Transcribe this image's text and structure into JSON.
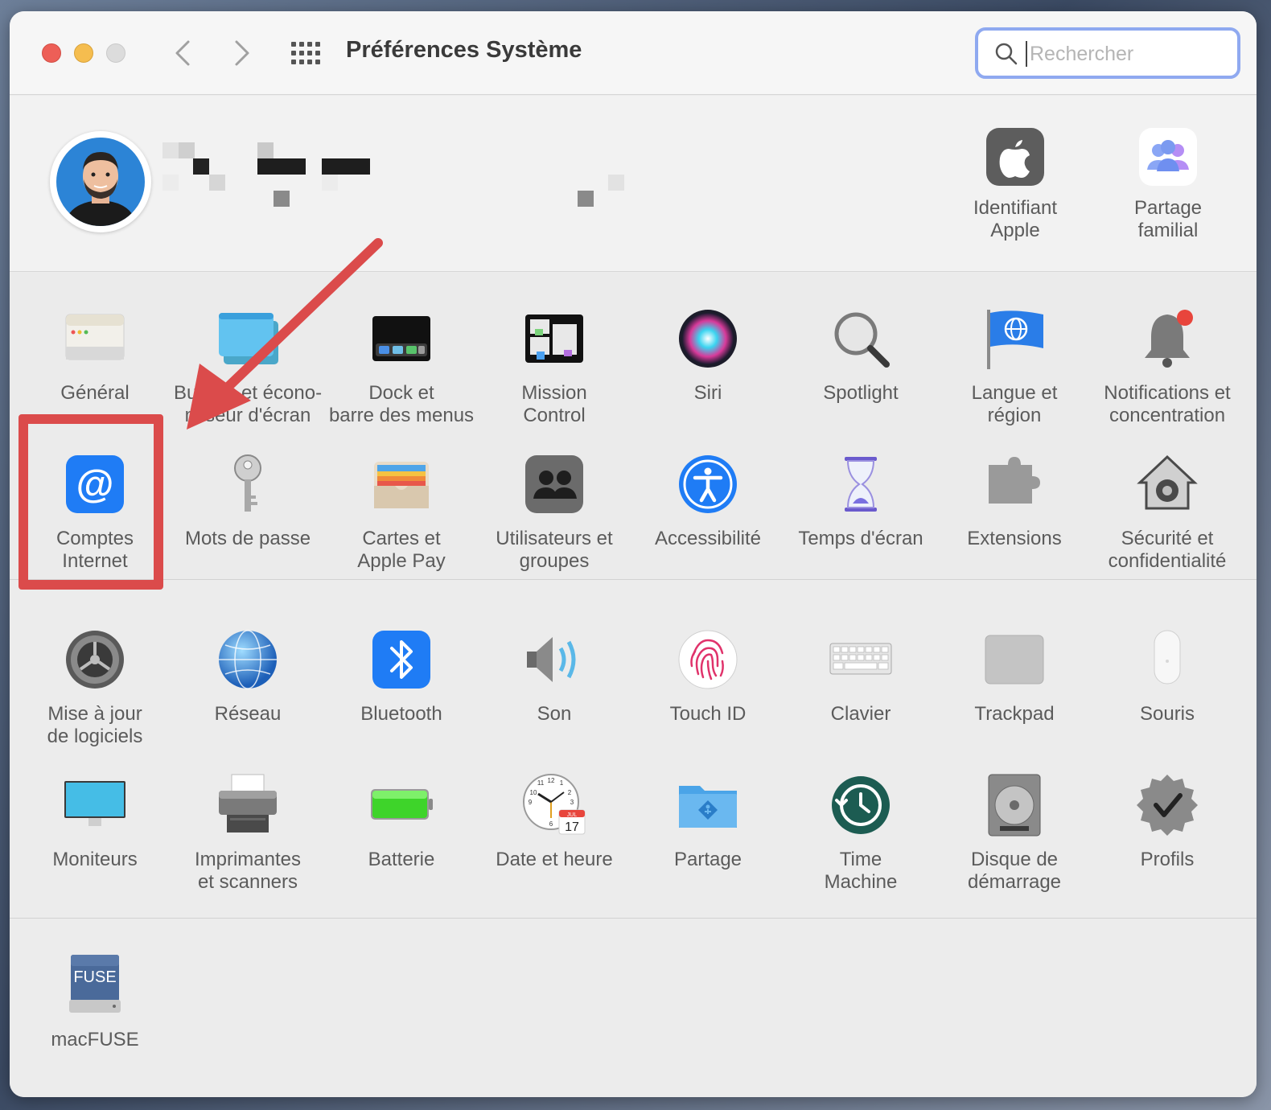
{
  "window": {
    "title": "Préférences Système",
    "search_placeholder": "Rechercher",
    "search_value": ""
  },
  "account": {
    "top_panes": [
      {
        "label_line1": "Identifiant",
        "label_line2": "Apple",
        "icon": "apple-id-icon"
      },
      {
        "label_line1": "Partage",
        "label_line2": "familial",
        "icon": "family-sharing-icon"
      }
    ]
  },
  "section1": [
    {
      "l1": "Général",
      "l2": "",
      "icon": "general-icon"
    },
    {
      "l1": "Bureau et écono-",
      "l2": "miseur d'écran",
      "icon": "desktop-icon"
    },
    {
      "l1": "Dock et",
      "l2": "barre des menus",
      "icon": "dock-icon"
    },
    {
      "l1": "Mission",
      "l2": "Control",
      "icon": "mission-control-icon"
    },
    {
      "l1": "Siri",
      "l2": "",
      "icon": "siri-icon"
    },
    {
      "l1": "Spotlight",
      "l2": "",
      "icon": "spotlight-icon"
    },
    {
      "l1": "Langue et",
      "l2": "région",
      "icon": "language-icon"
    },
    {
      "l1": "Notifications et",
      "l2": "concentration",
      "icon": "notifications-icon"
    },
    {
      "l1": "Comptes",
      "l2": "Internet",
      "icon": "internet-accounts-icon"
    },
    {
      "l1": "Mots de passe",
      "l2": "",
      "icon": "passwords-icon"
    },
    {
      "l1": "Cartes et",
      "l2": "Apple Pay",
      "icon": "wallet-icon"
    },
    {
      "l1": "Utilisateurs et",
      "l2": "groupes",
      "icon": "users-icon"
    },
    {
      "l1": "Accessibilité",
      "l2": "",
      "icon": "accessibility-icon"
    },
    {
      "l1": "Temps d'écran",
      "l2": "",
      "icon": "screen-time-icon"
    },
    {
      "l1": "Extensions",
      "l2": "",
      "icon": "extensions-icon"
    },
    {
      "l1": "Sécurité et",
      "l2": "confidentialité",
      "icon": "security-icon"
    }
  ],
  "section2": [
    {
      "l1": "Mise à jour",
      "l2": "de logiciels",
      "icon": "software-update-icon"
    },
    {
      "l1": "Réseau",
      "l2": "",
      "icon": "network-icon"
    },
    {
      "l1": "Bluetooth",
      "l2": "",
      "icon": "bluetooth-icon"
    },
    {
      "l1": "Son",
      "l2": "",
      "icon": "sound-icon"
    },
    {
      "l1": "Touch ID",
      "l2": "",
      "icon": "touch-id-icon"
    },
    {
      "l1": "Clavier",
      "l2": "",
      "icon": "keyboard-icon"
    },
    {
      "l1": "Trackpad",
      "l2": "",
      "icon": "trackpad-icon"
    },
    {
      "l1": "Souris",
      "l2": "",
      "icon": "mouse-icon"
    },
    {
      "l1": "Moniteurs",
      "l2": "",
      "icon": "displays-icon"
    },
    {
      "l1": "Imprimantes",
      "l2": "et scanners",
      "icon": "printer-icon"
    },
    {
      "l1": "Batterie",
      "l2": "",
      "icon": "battery-icon"
    },
    {
      "l1": "Date et heure",
      "l2": "",
      "icon": "date-time-icon"
    },
    {
      "l1": "Partage",
      "l2": "",
      "icon": "sharing-icon"
    },
    {
      "l1": "Time",
      "l2": "Machine",
      "icon": "time-machine-icon"
    },
    {
      "l1": "Disque de",
      "l2": "démarrage",
      "icon": "startup-disk-icon"
    },
    {
      "l1": "Profils",
      "l2": "",
      "icon": "profiles-icon"
    }
  ],
  "section3": [
    {
      "l1": "macFUSE",
      "l2": "",
      "icon": "macfuse-icon",
      "icon_text": "FUSE"
    }
  ],
  "date_icon": {
    "month": "JUL",
    "day": "17"
  },
  "colors": {
    "highlight": "#db4b4b",
    "search_focus": "#8fa9f0",
    "accent_blue": "#1f7cf5"
  }
}
